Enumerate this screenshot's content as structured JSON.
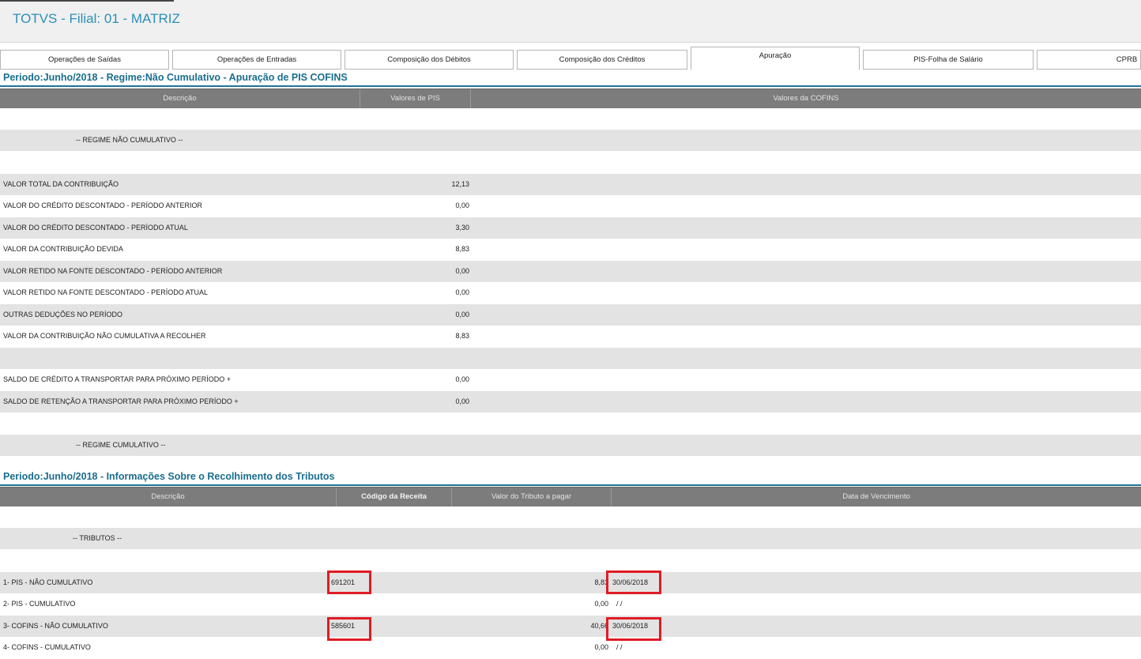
{
  "header": {
    "title": "TOTVS - Filial: 01 - MATRIZ"
  },
  "tabs": [
    "Operações de Saídas",
    "Operações de Entradas",
    "Composição dos Débitos",
    "Composição dos Créditos",
    "Apuração",
    "PIS-Folha de Salário",
    "CPRB"
  ],
  "active_tab": "Apuração",
  "apuracao": {
    "title": "Periodo:Junho/2018 - Regime:Não Cumulativo - Apuração de PIS COFINS",
    "columns": [
      "Descrição",
      "Valores de PIS",
      "Valores da COFINS"
    ],
    "rows": [
      {
        "desc": "",
        "pis": ""
      },
      {
        "desc": "-- REGIME NÃO CUMULATIVO --",
        "pis": ""
      },
      {
        "desc": "",
        "pis": ""
      },
      {
        "desc": "VALOR TOTAL DA CONTRIBUIÇÃO",
        "pis": "12,13"
      },
      {
        "desc": "VALOR DO CRÉDITO DESCONTADO - PERÍODO ANTERIOR",
        "pis": "0,00"
      },
      {
        "desc": "VALOR DO CRÉDITO DESCONTADO - PERÍODO ATUAL",
        "pis": "3,30"
      },
      {
        "desc": "VALOR DA CONTRIBUIÇÃO DEVIDA",
        "pis": "8,83"
      },
      {
        "desc": "VALOR RETIDO NA FONTE DESCONTADO - PERÍODO ANTERIOR",
        "pis": "0,00"
      },
      {
        "desc": "VALOR RETIDO NA FONTE DESCONTADO - PERÍODO ATUAL",
        "pis": "0,00"
      },
      {
        "desc": "OUTRAS DEDUÇÕES NO PERÍODO",
        "pis": "0,00"
      },
      {
        "desc": "VALOR DA CONTRIBUIÇÃO NÃO CUMULATIVA A RECOLHER",
        "pis": "8,83"
      },
      {
        "desc": "",
        "pis": ""
      },
      {
        "desc": "SALDO DE CRÉDITO A TRANSPORTAR PARA PRÓXIMO PERÍODO +",
        "pis": "0,00"
      },
      {
        "desc": "SALDO DE RETENÇÃO A TRANSPORTAR PARA PRÓXIMO PERÍODO +",
        "pis": "0,00"
      },
      {
        "desc": "",
        "pis": ""
      },
      {
        "desc": "-- REGIME CUMULATIVO --",
        "pis": ""
      }
    ]
  },
  "recolhimento": {
    "title": "Periodo:Junho/2018 - Informações Sobre o Recolhimento dos Tributos",
    "columns": [
      "Descrição",
      "Código da Receita",
      "Valor do Tributo a pagar",
      "Data de Vencimento"
    ],
    "rows": [
      {
        "desc": "",
        "codigo": "",
        "valor": "",
        "data": ""
      },
      {
        "desc": "-- TRIBUTOS --",
        "codigo": "",
        "valor": "",
        "data": ""
      },
      {
        "desc": "",
        "codigo": "",
        "valor": "",
        "data": ""
      },
      {
        "desc": "1- PIS - NÃO CUMULATIVO",
        "codigo": "691201",
        "valor": "8,83",
        "data": "30/06/2018"
      },
      {
        "desc": "2- PIS - CUMULATIVO",
        "codigo": "",
        "valor": "0,00",
        "data": "/ /"
      },
      {
        "desc": "3- COFINS - NÃO CUMULATIVO",
        "codigo": "585601",
        "valor": "40,66",
        "data": "30/06/2018"
      },
      {
        "desc": "4- COFINS - CUMULATIVO",
        "codigo": "",
        "valor": "0,00",
        "data": "/ /"
      }
    ]
  },
  "highlight_color": "#e01b24"
}
